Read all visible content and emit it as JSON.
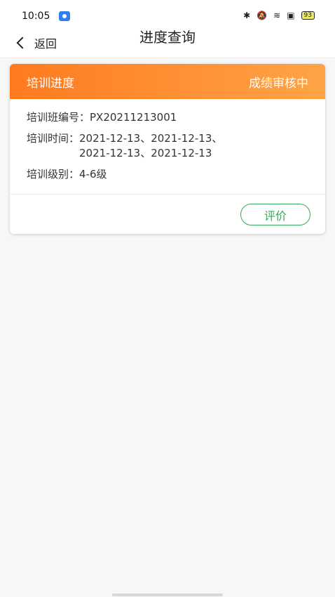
{
  "status_bar": {
    "time": "10:05",
    "icons": [
      "bluetooth-icon",
      "mute-icon",
      "wifi-icon",
      "screen-icon"
    ],
    "battery": "93"
  },
  "nav": {
    "back_label": "返回",
    "title": "进度查询"
  },
  "card": {
    "header_title": "培训进度",
    "header_status": "成绩审核中",
    "rows": [
      {
        "label": "培训班编号：",
        "value": "PX20211213001"
      },
      {
        "label": "培训时间：",
        "value": "2021-12-13、2021-12-13、\n2021-12-13、2021-12-13"
      },
      {
        "label": "培训级别：",
        "value": "4-6级"
      }
    ],
    "evaluate_label": "评价"
  },
  "colors": {
    "header_gradient_start": "#ff7a1f",
    "header_gradient_end": "#ffa347",
    "evaluate_green": "#3aa65a"
  }
}
